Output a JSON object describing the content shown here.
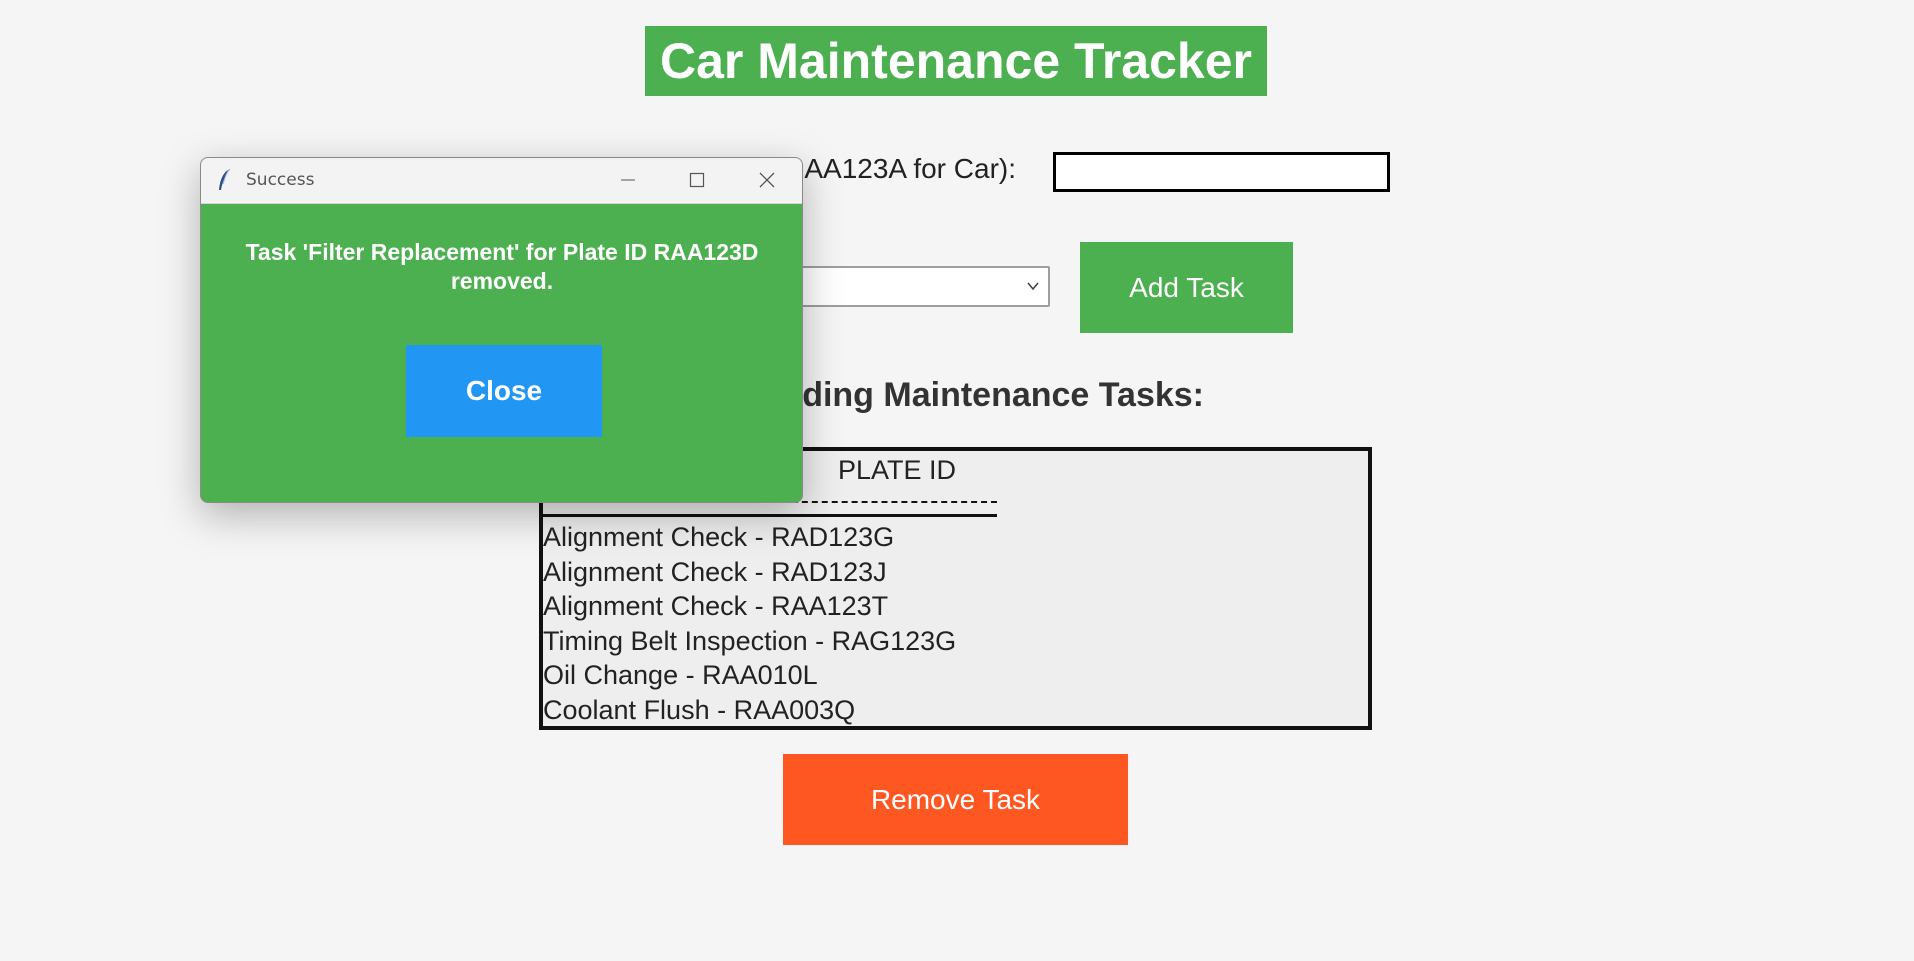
{
  "app": {
    "title": "Car Maintenance Tracker",
    "plate_label": "Enter Plate ID (e.g., RAA123A for Car):",
    "plate_input_value": "",
    "task_select_value": "",
    "add_button": "Add Task",
    "heading": "Pending Maintenance Tasks:",
    "list_header": "PLATE ID",
    "tasks": [
      "Alignment Check - RAD123G",
      "Alignment Check - RAD123J",
      "Alignment Check - RAA123T",
      "Timing Belt Inspection - RAG123G",
      "Oil Change - RAA010L",
      "Coolant Flush - RAA003Q"
    ],
    "remove_button": "Remove Task",
    "colors": {
      "title_bg": "#4caf50",
      "add_bg": "#4caf50",
      "remove_bg": "#ff5722"
    }
  },
  "dialog": {
    "title": "Success",
    "message": "Task 'Filter Replacement' for Plate ID RAA123D removed.",
    "close_button": "Close",
    "icons": [
      "feather-icon",
      "minimize-icon",
      "maximize-icon",
      "close-icon"
    ],
    "colors": {
      "body_bg": "#4caf50",
      "button_bg": "#2196f3"
    }
  }
}
